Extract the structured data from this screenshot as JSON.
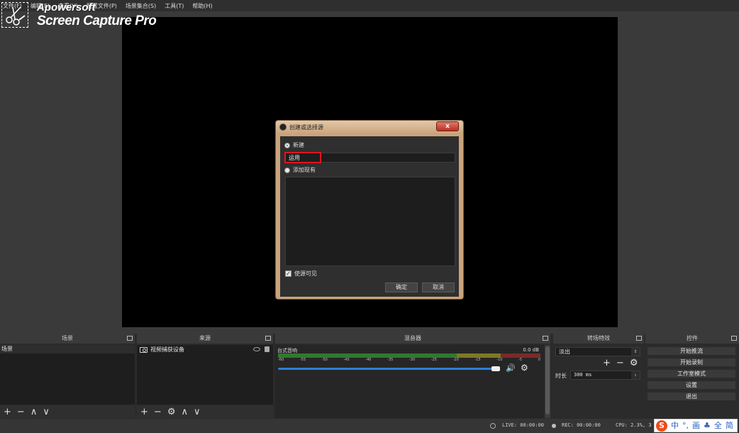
{
  "menu": {
    "items": [
      "文件(F)",
      "编辑(E)",
      "查看(V)",
      "配置文件(P)",
      "场景集合(S)",
      "工具(T)",
      "帮助(H)"
    ]
  },
  "watermark": {
    "brand": "Apowersoft",
    "product": "Screen Capture Pro"
  },
  "dialog": {
    "title": "创建或选择源",
    "close_label": "x",
    "new_label": "新建",
    "name_value": "运用",
    "existing_label": "添加现有",
    "visible_label": "使源可见",
    "ok_label": "确定",
    "cancel_label": "取消"
  },
  "docks": {
    "scenes": {
      "title": "场景",
      "selected": "场景"
    },
    "sources": {
      "title": "来源",
      "item": "视频捕获设备"
    },
    "mixer": {
      "title": "混音器",
      "channel": "台式音响",
      "db": "0.0 dB",
      "ticks": [
        "-60",
        "-55",
        "-50",
        "-45",
        "-40",
        "-35",
        "-30",
        "-25",
        "-20",
        "-15",
        "-10",
        "-5",
        "0"
      ],
      "volume_fraction": 0.99
    },
    "transitions": {
      "title": "转场特效",
      "selected": "淡出",
      "duration_label": "时长",
      "duration_value": "300 ms"
    },
    "controls": {
      "title": "控件",
      "buttons": [
        "开始推流",
        "开始录制",
        "工作室模式",
        "设置",
        "退出"
      ]
    }
  },
  "status": {
    "live": "LIVE: 00:00:00",
    "rec": "REC: 00:00:00",
    "cpu": "CPU: 2.3%, 3"
  },
  "ime": {
    "logo": "S",
    "items": [
      "中",
      "°,",
      "画",
      "♣",
      "全",
      "简"
    ]
  },
  "toolbar_glyphs": {
    "add": "+",
    "remove": "−",
    "up": "∧",
    "down": "∨",
    "gear": "⚙",
    "speaker": "🔊"
  },
  "colors": {
    "accent_blue": "#2f7fd8",
    "highlight_red": "#e0141e",
    "meter_green": "#2f7a2f",
    "meter_yellow": "#7d7a22",
    "meter_red": "#7b2a2a"
  }
}
